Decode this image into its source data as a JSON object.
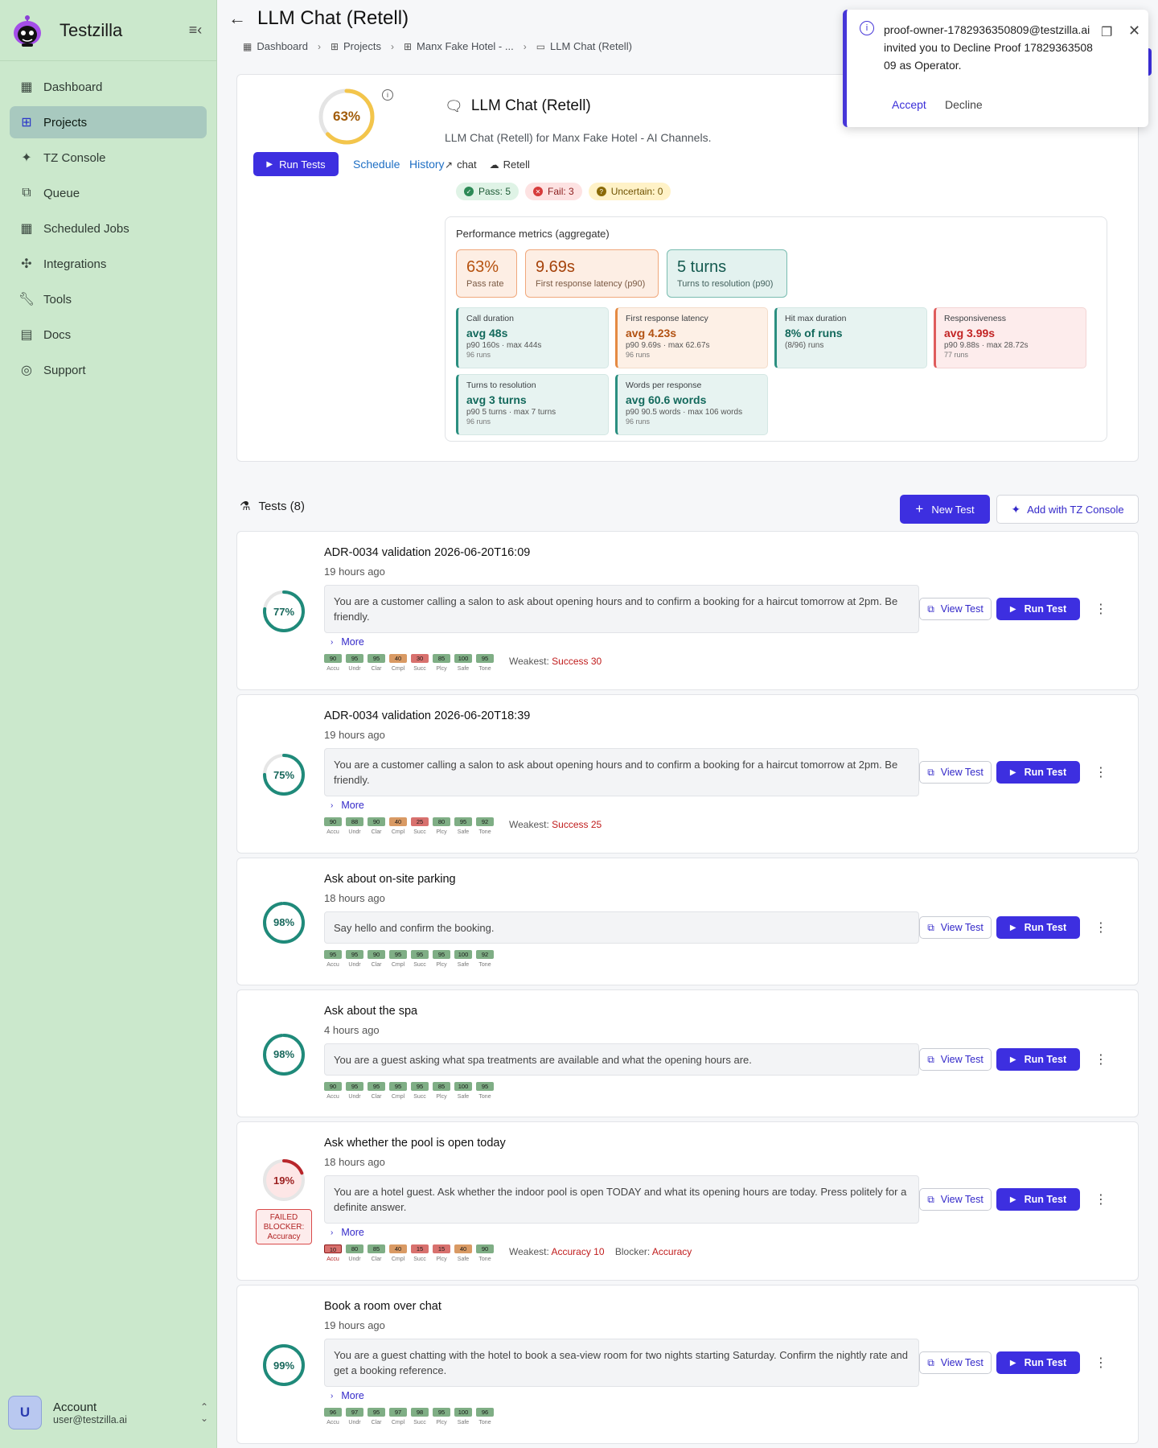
{
  "app": {
    "brand": "Testzilla"
  },
  "sidebar": {
    "items": [
      {
        "label": "Dashboard",
        "icon": "dashboard-icon"
      },
      {
        "label": "Projects",
        "icon": "projects-icon"
      },
      {
        "label": "TZ Console",
        "icon": "sparkle-icon"
      },
      {
        "label": "Queue",
        "icon": "queue-icon"
      },
      {
        "label": "Scheduled Jobs",
        "icon": "scheduled-jobs-icon"
      },
      {
        "label": "Integrations",
        "icon": "integrations-icon"
      },
      {
        "label": "Tools",
        "icon": "wrench-icon"
      },
      {
        "label": "Docs",
        "icon": "book-icon"
      },
      {
        "label": "Support",
        "icon": "support-icon"
      }
    ],
    "active": "Projects",
    "account": {
      "initial": "U",
      "name": "Account",
      "email": "user@testzilla.ai"
    }
  },
  "header": {
    "title": "LLM Chat (Retell)",
    "breadcrumbs": [
      "Dashboard",
      "Projects",
      "Manx Fake Hotel - ...",
      "LLM Chat (Retell)"
    ]
  },
  "agent": {
    "score": "63%",
    "score_value": 63,
    "run_label": "Run Tests",
    "schedule_label": "Schedule",
    "history_label": "History",
    "title": "LLM Chat (Retell)",
    "description": "LLM Chat (Retell) for Manx Fake Hotel - AI Channels.",
    "tag_chat": "chat",
    "tag_provider": "Retell",
    "pass": "Pass: 5",
    "fail": "Fail: 3",
    "uncertain": "Uncertain: 0"
  },
  "performance": {
    "title": "Performance metrics (aggregate)",
    "kpis": [
      {
        "value": "63%",
        "label": "Pass rate"
      },
      {
        "value": "9.69s",
        "label": "First response latency (p90)"
      },
      {
        "value": "5 turns",
        "label": "Turns to resolution (p90)"
      }
    ],
    "metrics": [
      {
        "title": "Call duration",
        "value": "avg 48s",
        "sub": "p90 160s · max 444s",
        "runs": "96 runs"
      },
      {
        "title": "First response latency",
        "value": "avg 4.23s",
        "sub": "p90 9.69s · max 62.67s",
        "runs": "96 runs"
      },
      {
        "title": "Hit max duration",
        "value": "8% of runs",
        "sub": "(8/96) runs",
        "runs": ""
      },
      {
        "title": "Responsiveness",
        "value": "avg 3.99s",
        "sub": "p90 9.88s · max 28.72s",
        "runs": "77 runs"
      },
      {
        "title": "Turns to resolution",
        "value": "avg 3 turns",
        "sub": "p90 5 turns · max 7 turns",
        "runs": "96 runs"
      },
      {
        "title": "Words per response",
        "value": "avg 60.6 words",
        "sub": "p90 90.5 words · max 106 words",
        "runs": "96 runs"
      }
    ]
  },
  "toast": {
    "message": "proof-owner-1782936350809@testzilla.ai invited you to Decline Proof 1782936350809 as Operator.",
    "accept": "Accept",
    "decline": "Decline"
  },
  "tests": {
    "heading": "Tests (8)",
    "new_label": "New Test",
    "add_label": "Add with TZ Console",
    "view_label": "View Test",
    "run_label": "Run Test",
    "more_label": "More",
    "weakest_prefix": "Weakest:",
    "blocker_prefix": "Blocker:",
    "score_labels": [
      "Accu",
      "Undr",
      "Clar",
      "Cmpl",
      "Succ",
      "Plcy",
      "Safe",
      "Tone"
    ],
    "items": [
      {
        "name": "ADR-0034 validation 2026-06-20T16:09",
        "ago": "19 hours ago",
        "score": "77%",
        "value": 77,
        "prompt": "You are a customer calling a salon to ask about opening hours and to confirm a booking for a haircut tomorrow at 2pm. Be friendly.",
        "scores": [
          "90",
          "95",
          "95",
          "40",
          "30",
          "85",
          "100",
          "95"
        ],
        "weakest": "Success 30"
      },
      {
        "name": "ADR-0034 validation 2026-06-20T18:39",
        "ago": "19 hours ago",
        "score": "75%",
        "value": 75,
        "prompt": "You are a customer calling a salon to ask about opening hours and to confirm a booking for a haircut tomorrow at 2pm. Be friendly.",
        "scores": [
          "90",
          "88",
          "90",
          "40",
          "25",
          "80",
          "95",
          "92"
        ],
        "weakest": "Success 25"
      },
      {
        "name": "Ask about on-site parking",
        "ago": "18 hours ago",
        "score": "98%",
        "value": 98,
        "prompt": "Say hello and confirm the booking.",
        "scores": [
          "95",
          "95",
          "90",
          "95",
          "95",
          "95",
          "100",
          "92"
        ]
      },
      {
        "name": "Ask about the spa",
        "ago": "4 hours ago",
        "score": "98%",
        "value": 98,
        "prompt": "You are a guest asking what spa treatments are available and what the opening hours are.",
        "scores": [
          "90",
          "95",
          "95",
          "95",
          "95",
          "85",
          "100",
          "95"
        ]
      },
      {
        "name": "Ask whether the pool is open today",
        "ago": "18 hours ago",
        "score": "19%",
        "value": 19,
        "prompt": "You are a hotel guest. Ask whether the indoor pool is open TODAY and what its opening hours are today. Press politely for a definite answer.",
        "scores": [
          "10",
          "80",
          "85",
          "40",
          "15",
          "15",
          "40",
          "90"
        ],
        "weakest": "Accuracy 10",
        "blocker": "Accuracy",
        "badge": [
          "FAILED",
          "BLOCKER:",
          "Accuracy"
        ]
      },
      {
        "name": "Book a room over chat",
        "ago": "19 hours ago",
        "score": "99%",
        "value": 99,
        "prompt": "You are a guest chatting with the hotel to book a sea-view room for two nights starting Saturday. Confirm the nightly rate and get a booking reference.",
        "scores": [
          "96",
          "97",
          "95",
          "97",
          "98",
          "95",
          "100",
          "96"
        ]
      }
    ]
  }
}
